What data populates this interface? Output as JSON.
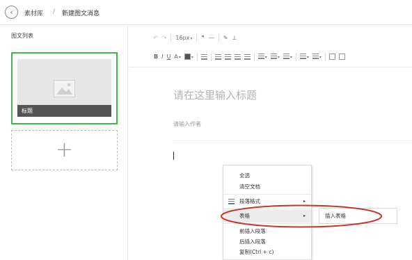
{
  "header": {
    "back_icon": "back-arrow-icon",
    "breadcrumb_link": "素材库",
    "breadcrumb_sep": "/",
    "breadcrumb_current": "新建图文消息"
  },
  "sidebar": {
    "title": "图文列表",
    "card": {
      "title": "标题",
      "thumb_icon": "image-placeholder-icon"
    },
    "add_label": "+",
    "accent_color": "#44b549"
  },
  "toolbar": {
    "row1": {
      "undo_icon": "↶",
      "redo_icon": "↷",
      "font_size": "16px",
      "quote_icon": "❞",
      "hr_icon": "—",
      "clear_format_icon": "✎",
      "format_painter_icon": "🖌"
    },
    "row2": {
      "bold": "B",
      "italic": "I",
      "underline": "U",
      "font_color": "A",
      "caret": "▾"
    }
  },
  "editor": {
    "title_placeholder": "请在这里输入标题",
    "author_placeholder": "请输入作者"
  },
  "context_menu": {
    "items": [
      {
        "label": "全选"
      },
      {
        "label": "清空文档"
      },
      {
        "label": "段落格式",
        "arrow": "▸"
      },
      {
        "label": "表格",
        "arrow": "▸"
      },
      {
        "label": "前插入段落"
      },
      {
        "label": "后插入段落"
      },
      {
        "label": "复制(Ctrl + c)"
      }
    ],
    "submenu": {
      "item": "插入表格"
    }
  },
  "annotation_color": "#c0392b"
}
